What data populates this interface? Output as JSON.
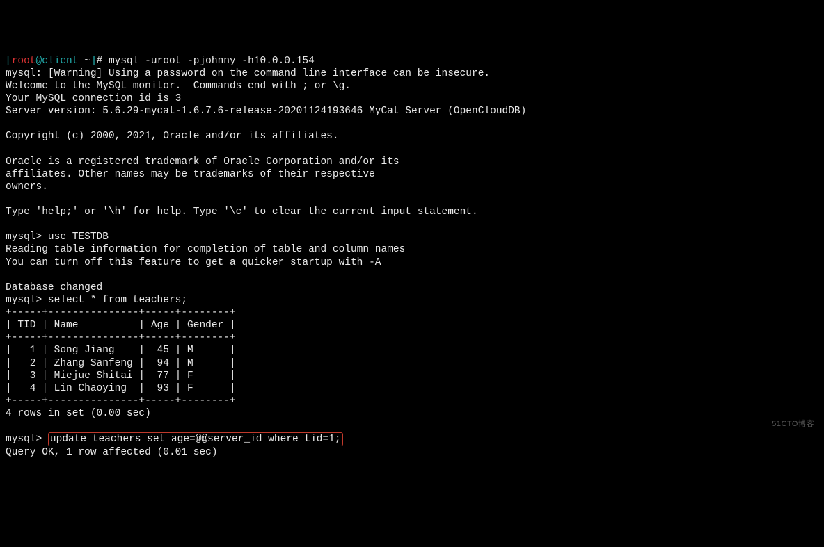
{
  "prompt": {
    "lb": "[",
    "user": "root",
    "at": "@",
    "host": "client",
    "path": " ~",
    "rb": "]",
    "hash": "# ",
    "cmd": "mysql -uroot -pjohnny -h10.0.0.154"
  },
  "banner": {
    "l1": "mysql: [Warning] Using a password on the command line interface can be insecure.",
    "l2": "Welcome to the MySQL monitor.  Commands end with ; or \\g.",
    "l3": "Your MySQL connection id is 3",
    "l4": "Server version: 5.6.29-mycat-1.6.7.6-release-20201124193646 MyCat Server (OpenCloudDB)",
    "l5": "Copyright (c) 2000, 2021, Oracle and/or its affiliates.",
    "l6": "Oracle is a registered trademark of Oracle Corporation and/or its",
    "l7": "affiliates. Other names may be trademarks of their respective",
    "l8": "owners.",
    "l9": "Type 'help;' or '\\h' for help. Type '\\c' to clear the current input statement."
  },
  "sql": {
    "prompt": "mysql> ",
    "use": "use TESTDB",
    "read1": "Reading table information for completion of table and column names",
    "read2": "You can turn off this feature to get a quicker startup with -A",
    "dbchanged": "Database changed",
    "select": "select * from teachers;",
    "update": "update teachers set age=@@server_id where tid=1;",
    "queryok": "Query OK, 1 row affected (0.01 sec)"
  },
  "table": {
    "border": "+-----+---------------+-----+--------+",
    "header": "| TID | Name          | Age | Gender |",
    "rows": [
      "|   1 | Song Jiang    |  45 | M      |",
      "|   2 | Zhang Sanfeng |  94 | M      |",
      "|   3 | Miejue Shitai |  77 | F      |",
      "|   4 | Lin Chaoying  |  93 | F      |"
    ],
    "summary": "4 rows in set (0.00 sec)"
  },
  "watermark": "51CTO博客"
}
